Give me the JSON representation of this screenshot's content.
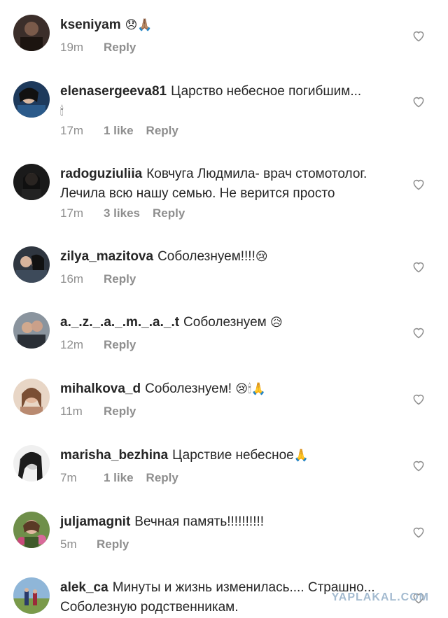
{
  "comments": [
    {
      "user": "kseniyam",
      "text": "",
      "emoji": "😞🙏🏽",
      "time": "19m",
      "likes": "",
      "reply": "Reply",
      "avatar_color": "#3b2e2a"
    },
    {
      "user": "elenasergeeva81",
      "text": "Царство небесное погибшим...",
      "emoji": "🕯",
      "time": "17m",
      "likes": "1 like",
      "reply": "Reply",
      "avatar_color": "#1e3a5c"
    },
    {
      "user": "radoguziuliia",
      "text": "Ковчуга Людмила- врач стомотолог. Лечила всю нашу семью. Не верится просто",
      "emoji": "",
      "time": "17m",
      "likes": "3 likes",
      "reply": "Reply",
      "avatar_color": "#1a1a1a"
    },
    {
      "user": "zilya_mazitova",
      "text": "Соболезнуем!!!!",
      "emoji": "😢",
      "time": "16m",
      "likes": "",
      "reply": "Reply",
      "avatar_color": "#2f3640"
    },
    {
      "user": "a._.z._.a._.m._.a._.t",
      "text": "Соболезнуем",
      "emoji": "😥",
      "time": "12m",
      "likes": "",
      "reply": "Reply",
      "avatar_color": "#5a6472"
    },
    {
      "user": "mihalkova_d",
      "text": "Соболезнуем!",
      "emoji": "😢🕯🙏",
      "time": "11m",
      "likes": "",
      "reply": "Reply",
      "avatar_color": "#c89a7c"
    },
    {
      "user": "marisha_bezhina",
      "text": "Царствие небесное",
      "emoji": "🙏",
      "time": "7m",
      "likes": "1 like",
      "reply": "Reply",
      "avatar_color": "#2b2b2b"
    },
    {
      "user": "juljamagnit",
      "text": "Вечная память!!!!!!!!!!",
      "emoji": "",
      "time": "5m",
      "likes": "",
      "reply": "Reply",
      "avatar_color": "#5b7a3a"
    },
    {
      "user": "alek_ca",
      "text": "Минуты и жизнь  изменилась.... Страшно... Соболезную родственникам.",
      "emoji": "",
      "time": "",
      "likes": "",
      "reply": "",
      "avatar_color": "#7ea6c9"
    }
  ],
  "watermark": "YAPLAKAL.COM",
  "icons": {
    "like": "heart-outline-icon"
  }
}
